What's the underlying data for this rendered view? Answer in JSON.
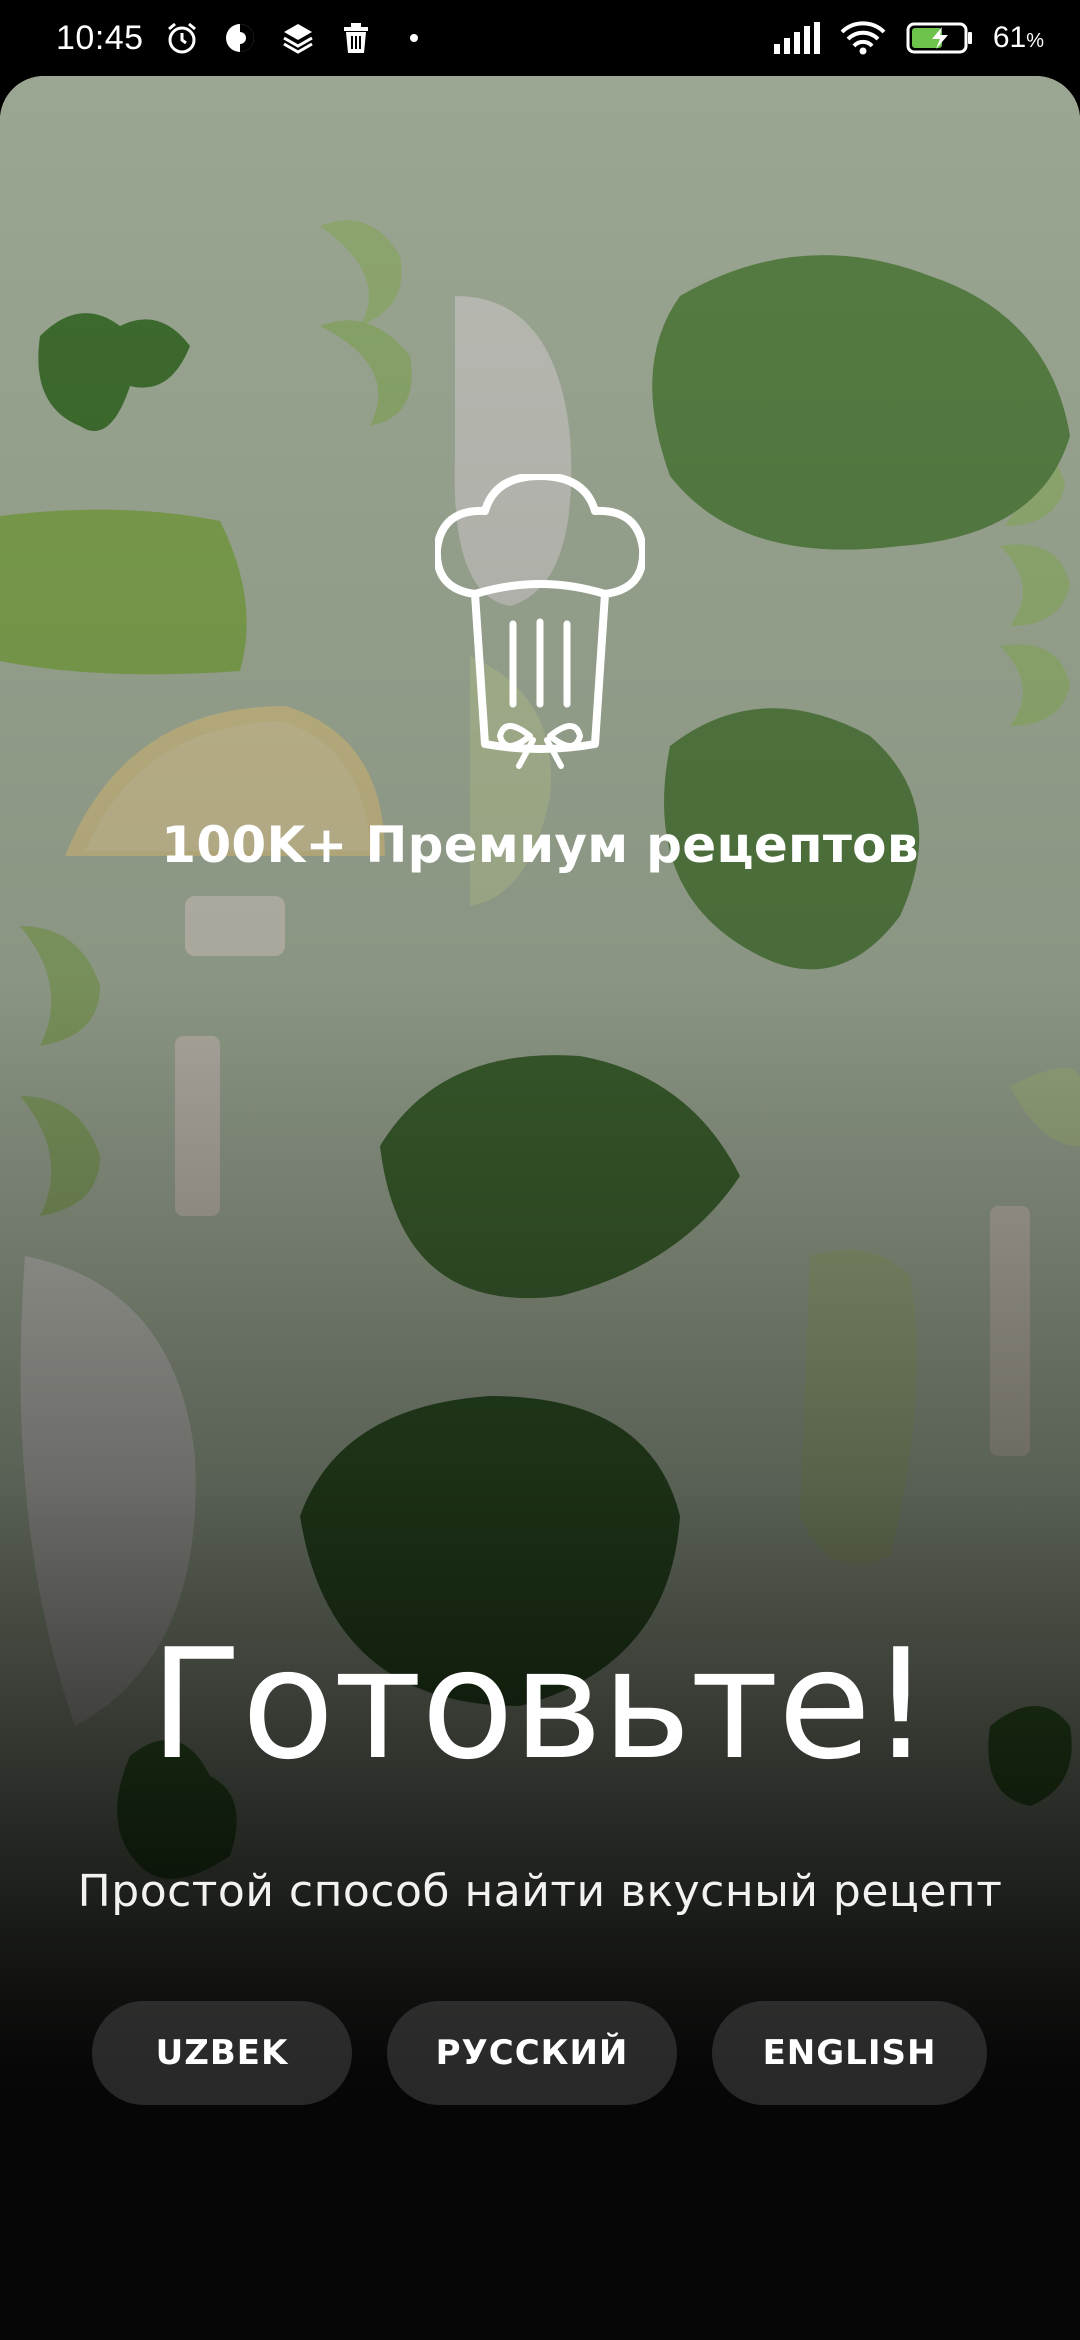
{
  "status_bar": {
    "time": "10:45",
    "battery_percent": "61",
    "battery_unit": "%",
    "icons_left": [
      "alarm-icon",
      "data-saver-icon",
      "layers-icon",
      "trash-icon",
      "dot-icon"
    ],
    "icons_right": [
      "signal-icon",
      "wifi-icon",
      "battery-charging-icon"
    ]
  },
  "onboarding": {
    "logo_icon": "chef-hat-icon",
    "tagline": "100K+ Премиум рецептов",
    "headline": "Готовьте!",
    "subtitle": "Простой способ найти вкусный рецепт"
  },
  "languages": [
    {
      "label": "UZBEK"
    },
    {
      "label": "РУССКИЙ"
    },
    {
      "label": "ENGLISH"
    }
  ],
  "colors": {
    "background_tint": "#c8d6bd",
    "button_bg": "#464646",
    "text": "#ffffff"
  }
}
